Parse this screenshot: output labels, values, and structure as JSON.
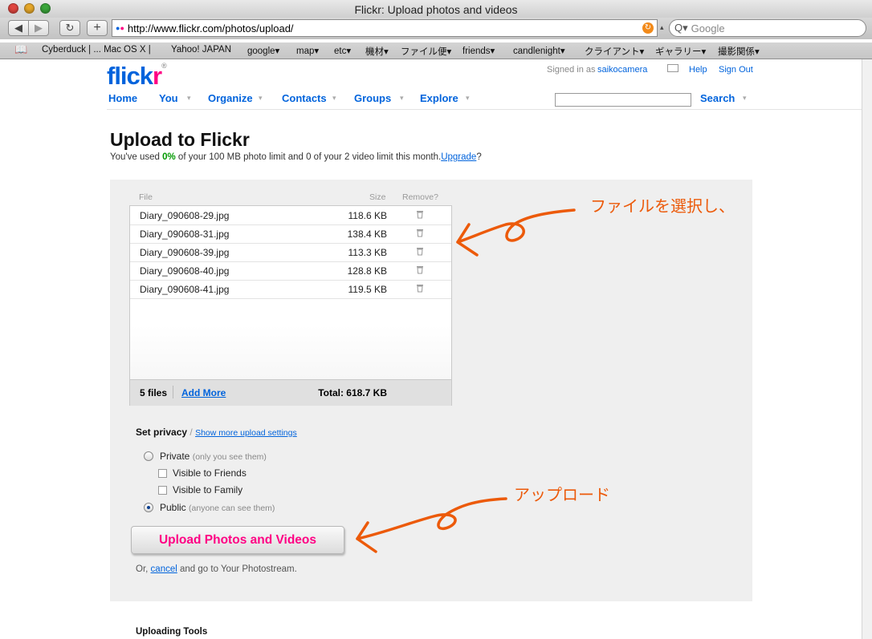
{
  "window": {
    "title": "Flickr: Upload photos and videos"
  },
  "toolbar": {
    "url": "http://www.flickr.com/photos/upload/",
    "search_placeholder": "Google"
  },
  "bookmarks": [
    "Cyberduck | ... Mac OS X |",
    "Yahoo! JAPAN",
    "google▾",
    "map▾",
    "etc▾",
    "機材▾",
    "ファイル便▾",
    "friends▾",
    "candlenight▾",
    "クライアント▾",
    "ギャラリー▾",
    "撮影関係▾"
  ],
  "header": {
    "signed_in_prefix": "Signed in as",
    "username": "saikocamera",
    "help": "Help",
    "sign_out": "Sign Out",
    "nav": [
      "Home",
      "You",
      "Organize",
      "Contacts",
      "Groups",
      "Explore"
    ],
    "search_button": "Search"
  },
  "main": {
    "title": "Upload to Flickr",
    "quota_pre": "You've used",
    "quota_percent": "0%",
    "quota_mid": "of your 100 MB photo limit and 0 of your 2 video limit this month.",
    "upgrade": "Upgrade",
    "quota_end": "?"
  },
  "files": {
    "col_file": "File",
    "col_size": "Size",
    "col_remove": "Remove?",
    "rows": [
      {
        "name": "Diary_090608-29.jpg",
        "size": "118.6 KB"
      },
      {
        "name": "Diary_090608-31.jpg",
        "size": "138.4 KB"
      },
      {
        "name": "Diary_090608-39.jpg",
        "size": "113.3 KB"
      },
      {
        "name": "Diary_090608-40.jpg",
        "size": "128.8 KB"
      },
      {
        "name": "Diary_090608-41.jpg",
        "size": "119.5 KB"
      }
    ],
    "count": "5 files",
    "add_more": "Add More",
    "total": "Total: 618.7 KB"
  },
  "privacy": {
    "title": "Set privacy",
    "separator": "/",
    "more_settings": "Show more upload settings",
    "private_label": "Private",
    "private_hint": "(only you see them)",
    "friends_label": "Visible to Friends",
    "family_label": "Visible to Family",
    "public_label": "Public",
    "public_hint": "(anyone can see them)",
    "selected": "Public"
  },
  "actions": {
    "upload": "Upload Photos and Videos",
    "or": "Or,",
    "cancel": "cancel",
    "cancel_rest": "and go to Your Photostream."
  },
  "tools": {
    "title": "Uploading Tools"
  },
  "annotations": {
    "select_files": "ファイルを選択し、",
    "upload": "アップロード",
    "color": "#ec5a0a"
  },
  "colors": {
    "flickr_blue": "#0063dc",
    "flickr_pink": "#ff0084"
  }
}
